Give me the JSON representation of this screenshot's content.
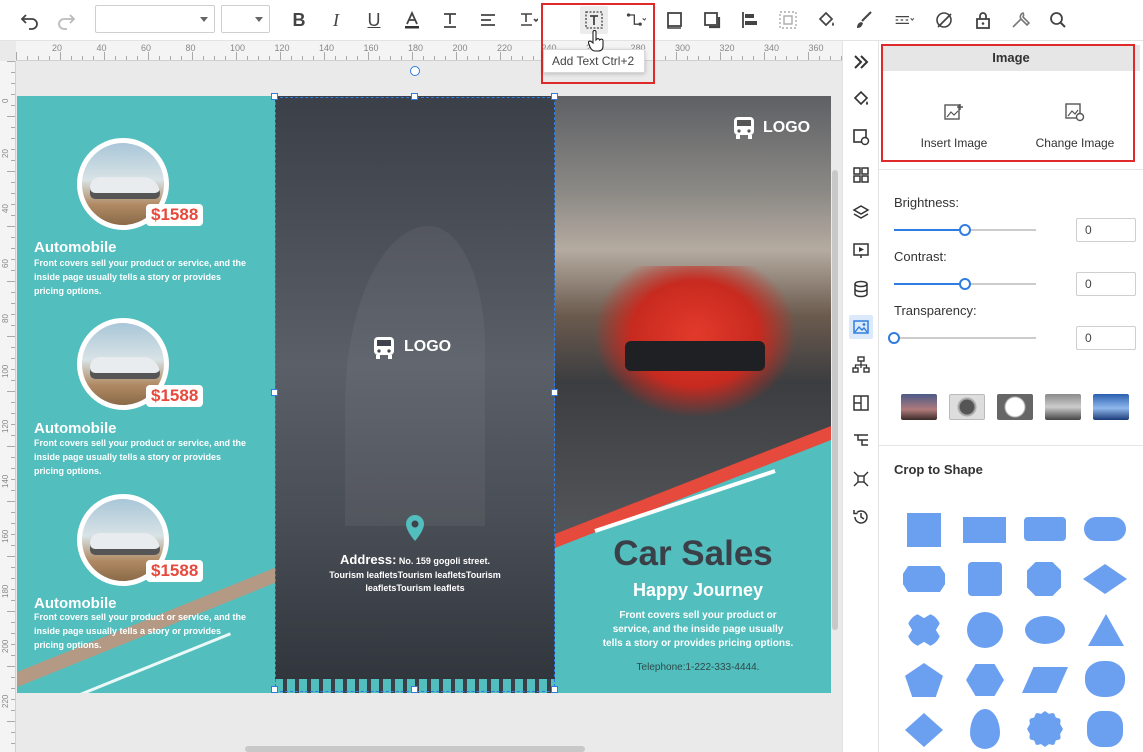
{
  "toolbar": {
    "font_family_value": "",
    "font_size_value": "",
    "tooltip": "Add Text Ctrl+2"
  },
  "ruler": {
    "h_ticks": [
      "20",
      "40",
      "60",
      "80",
      "100",
      "120",
      "140",
      "160",
      "180",
      "200",
      "220",
      "240",
      "260",
      "280",
      "300",
      "320",
      "340",
      "360"
    ],
    "v_ticks": [
      "0",
      "20",
      "40",
      "60",
      "80",
      "100",
      "120",
      "140",
      "160",
      "180",
      "200",
      "220"
    ]
  },
  "brochure": {
    "left_items": [
      {
        "price": "$1588",
        "title": "Automobile",
        "desc": "Front covers sell your product or service, and the inside page usually tells a story or provides pricing options."
      },
      {
        "price": "$1588",
        "title": "Automobile",
        "desc": "Front covers sell your product or service, and the inside page usually tells a story or provides pricing options."
      },
      {
        "price": "$1588",
        "title": "Automobile",
        "desc": "Front covers sell your product or service, and the inside page usually tells a story or provides pricing options."
      }
    ],
    "mid_logo": "LOGO",
    "address_label": "Address:",
    "address_text": "No. 159 gogoli street.",
    "address_line2": "Tourism leafletsTourism leafletsTourism",
    "address_line3": "leafletsTourism leaflets",
    "right_logo": "LOGO",
    "headline": "Car Sales",
    "subheadline": "Happy Journey",
    "right_desc_1": "Front covers sell your product or",
    "right_desc_2": "service, and the inside page usually",
    "right_desc_3": "tells a story or provides pricing options.",
    "telephone": "Telephone:1-222-333-4444."
  },
  "props": {
    "section_title": "Image",
    "insert_image": "Insert Image",
    "change_image": "Change Image",
    "brightness_label": "Brightness:",
    "brightness_value": "0",
    "brightness_level": 0.5,
    "contrast_label": "Contrast:",
    "contrast_value": "0",
    "contrast_level": 0.5,
    "transparency_label": "Transparency:",
    "transparency_value": "0",
    "transparency_level": 0,
    "crop_title": "Crop to Shape"
  },
  "colors": {
    "accent": "#2f7de1",
    "teal": "#52bebd",
    "shape_blue": "#6ba0f1",
    "price_red": "#e64a3d",
    "highlight_red": "#e02a2a"
  }
}
